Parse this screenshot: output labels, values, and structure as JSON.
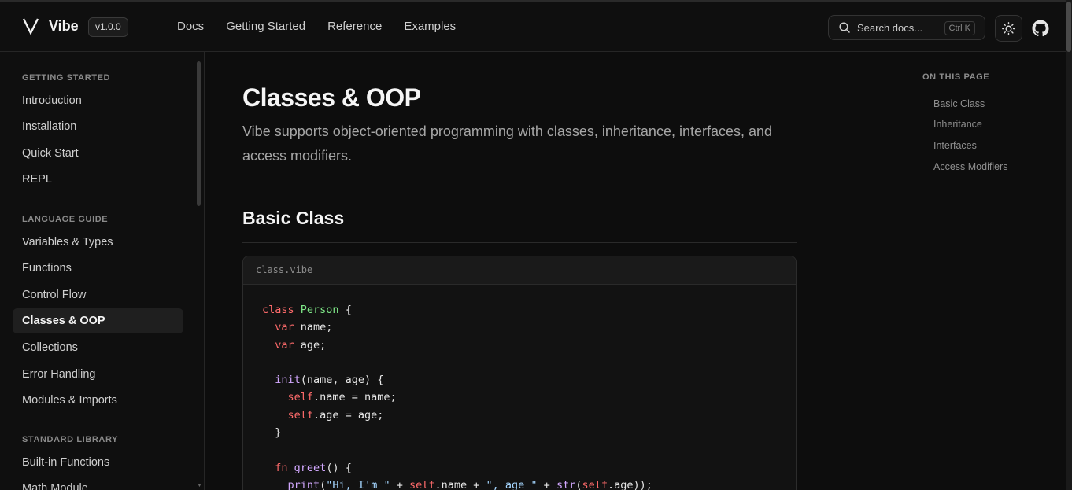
{
  "header": {
    "brand": "Vibe",
    "version": "v1.0.0",
    "nav": [
      "Docs",
      "Getting Started",
      "Reference",
      "Examples"
    ],
    "search_placeholder": "Search docs...",
    "search_shortcut": "Ctrl K",
    "icons": [
      "vibe-logo-icon",
      "search-icon",
      "sun-icon",
      "github-icon"
    ]
  },
  "sidebar": {
    "sections": [
      {
        "title": "GETTING STARTED",
        "items": [
          "Introduction",
          "Installation",
          "Quick Start",
          "REPL"
        ]
      },
      {
        "title": "LANGUAGE GUIDE",
        "items": [
          "Variables & Types",
          "Functions",
          "Control Flow",
          "Classes & OOP",
          "Collections",
          "Error Handling",
          "Modules & Imports"
        ]
      },
      {
        "title": "STANDARD LIBRARY",
        "items": [
          "Built-in Functions",
          "Math Module"
        ]
      }
    ],
    "active": "Classes & OOP"
  },
  "main": {
    "title": "Classes & OOP",
    "lead": "Vibe supports object-oriented programming with classes, inheritance, interfaces, and access modifiers.",
    "section_title": "Basic Class",
    "code_file": "class.vibe",
    "code_lines": [
      "class Person {",
      "  var name;",
      "  var age;",
      "",
      "  init(name, age) {",
      "    self.name = name;",
      "    self.age = age;",
      "  }",
      "",
      "  fn greet() {",
      "    print(\"Hi, I'm \" + self.name + \", age \" + str(self.age));"
    ]
  },
  "toc": {
    "title": "ON THIS PAGE",
    "items": [
      "Basic Class",
      "Inheritance",
      "Interfaces",
      "Access Modifiers"
    ]
  },
  "colors": {
    "background": "#0d0d0d",
    "keyword": "#ff6b6b",
    "type": "#7ee787",
    "function": "#d2a8ff",
    "string": "#a5d6ff"
  }
}
